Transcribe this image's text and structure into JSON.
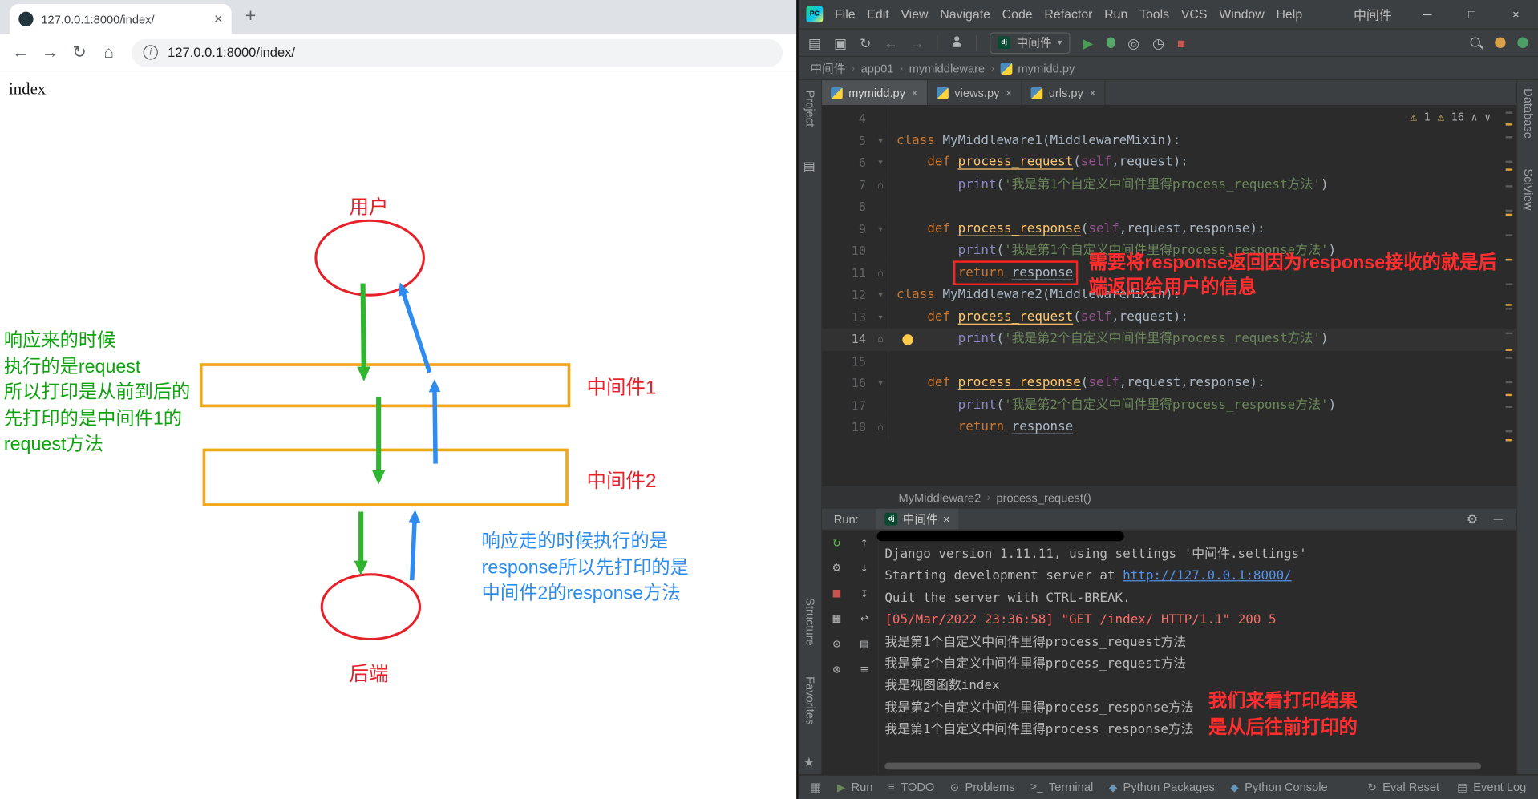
{
  "icons": {
    "close": "×",
    "new_tab": "+",
    "back": "←",
    "forward": "→",
    "reload": "↻",
    "home": "⌂",
    "info": "i",
    "min": "─",
    "max": "□",
    "win_close": "×",
    "crumb_sep": "›",
    "warning": "⚠",
    "up": "∧",
    "down": "∨",
    "gear": "⚙",
    "hide": "─",
    "dropdown": "▾",
    "folder": "▤",
    "star": "★",
    "grid": "▦",
    "django": "dj",
    "pycharm": "PC"
  },
  "browser": {
    "tab_title": "127.0.0.1:8000/index/",
    "url": "127.0.0.1:8000/index/",
    "page_heading": "index",
    "diagram": {
      "user_label": "用户",
      "mw1_label": "中间件1",
      "mw2_label": "中间件2",
      "backend_label": "后端",
      "green_note": [
        "响应来的时候",
        "执行的是request",
        "所以打印是从前到后的",
        "先打印的是中间件1的",
        "request方法"
      ],
      "blue_note": [
        "响应走的时候执行的是",
        "response所以先打印的是",
        "中间件2的response方法"
      ],
      "colors": {
        "shape_red": "#e62129",
        "box_yellow": "#efa71c",
        "arrow_green": "#2fb52f",
        "arrow_blue": "#2e8bf0",
        "green_text": "#0fa30f",
        "blue_text": "#2b8ced"
      }
    }
  },
  "ide": {
    "project_title": "中间件",
    "menus": [
      "File",
      "Edit",
      "View",
      "Navigate",
      "Code",
      "Refactor",
      "Run",
      "Tools",
      "VCS",
      "Window",
      "Help"
    ],
    "toolbar": {
      "pre_icons": [
        {
          "name": "open-icon",
          "glyph": "▤",
          "color": "#afb1b3"
        },
        {
          "name": "save-icon",
          "glyph": "▣",
          "color": "#afb1b3"
        },
        {
          "name": "sync-icon",
          "glyph": "↻",
          "color": "#afb1b3"
        },
        {
          "name": "back-icon",
          "glyph": "←",
          "color": "#afb1b3"
        },
        {
          "name": "forward-icon",
          "glyph": "→",
          "color": "#787b7e"
        }
      ],
      "config_name": "中间件",
      "post_icons": [
        {
          "name": "run-icon",
          "glyph": "▶",
          "color": "#499c54"
        },
        {
          "name": "coverage-icon",
          "glyph": "◎",
          "color": "#afb1b3"
        },
        {
          "name": "profiler-icon",
          "glyph": "◷",
          "color": "#afb1b3"
        },
        {
          "name": "stop-icon",
          "glyph": "■",
          "color": "#c75450"
        }
      ]
    },
    "breadcrumbs": [
      "中间件",
      "app01",
      "mymiddleware",
      "mymidd.py"
    ],
    "left_strip": [
      "Project",
      "Structure",
      "Favorites"
    ],
    "right_strip": [
      "Database",
      "SciView"
    ],
    "tabs": [
      {
        "label": "mymidd.py",
        "active": true
      },
      {
        "label": "views.py",
        "active": false
      },
      {
        "label": "urls.py",
        "active": false
      }
    ],
    "inspections": {
      "w1": "1",
      "w2": "16"
    },
    "editor_lines": [
      {
        "n": 4,
        "t": []
      },
      {
        "n": 5,
        "fold": "arrow",
        "t": [
          [
            "k",
            "class "
          ],
          [
            "p",
            "MyMiddleware1(MiddlewareMixin):"
          ]
        ]
      },
      {
        "n": 6,
        "fold": "arrow",
        "t": [
          [
            "p",
            "    "
          ],
          [
            "k",
            "def "
          ],
          [
            "f",
            "process_request"
          ],
          [
            "p",
            "("
          ],
          [
            "s",
            "self"
          ],
          [
            "p",
            ","
          ],
          [
            "p",
            "request"
          ],
          [
            "p",
            "):"
          ]
        ]
      },
      {
        "n": 7,
        "fold": "end",
        "t": [
          [
            "p",
            "        "
          ],
          [
            "b",
            "print"
          ],
          [
            "p",
            "("
          ],
          [
            "g",
            "'我是第1个自定义中间件里得process_request方法'"
          ],
          [
            "p",
            ")"
          ]
        ]
      },
      {
        "n": 8,
        "t": []
      },
      {
        "n": 9,
        "fold": "arrow",
        "t": [
          [
            "p",
            "    "
          ],
          [
            "k",
            "def "
          ],
          [
            "f",
            "process_response"
          ],
          [
            "p",
            "("
          ],
          [
            "s",
            "self"
          ],
          [
            "p",
            ","
          ],
          [
            "p",
            "request"
          ],
          [
            "p",
            ","
          ],
          [
            "p",
            "response"
          ],
          [
            "p",
            "):"
          ]
        ]
      },
      {
        "n": 10,
        "t": [
          [
            "p",
            "        "
          ],
          [
            "b",
            "print"
          ],
          [
            "p",
            "("
          ],
          [
            "g",
            "'我是第1个自定义中间件里得process_response方法'"
          ],
          [
            "p",
            ")"
          ]
        ]
      },
      {
        "n": 11,
        "fold": "end",
        "box": true,
        "t": [
          [
            "p",
            "        "
          ],
          [
            "k",
            "return "
          ],
          [
            "u",
            "response"
          ]
        ]
      },
      {
        "n": 12,
        "fold": "arrow",
        "t": [
          [
            "k",
            "class "
          ],
          [
            "p",
            "MyMiddleware2(MiddlewareMixin):"
          ]
        ]
      },
      {
        "n": 13,
        "fold": "arrow",
        "t": [
          [
            "p",
            "    "
          ],
          [
            "k",
            "def "
          ],
          [
            "f",
            "process_request"
          ],
          [
            "p",
            "("
          ],
          [
            "s",
            "self"
          ],
          [
            "p",
            ","
          ],
          [
            "p",
            "request"
          ],
          [
            "p",
            "):"
          ]
        ]
      },
      {
        "n": 14,
        "current": true,
        "bulb": true,
        "fold": "end",
        "t": [
          [
            "p",
            "        "
          ],
          [
            "b",
            "print"
          ],
          [
            "p",
            "("
          ],
          [
            "g",
            "'我是第2个自定义中间件里得process_request方法'"
          ],
          [
            "p",
            ")"
          ]
        ]
      },
      {
        "n": 15,
        "t": []
      },
      {
        "n": 16,
        "fold": "arrow",
        "t": [
          [
            "p",
            "    "
          ],
          [
            "k",
            "def "
          ],
          [
            "f",
            "process_response"
          ],
          [
            "p",
            "("
          ],
          [
            "s",
            "self"
          ],
          [
            "p",
            ","
          ],
          [
            "p",
            "request"
          ],
          [
            "p",
            ","
          ],
          [
            "p",
            "response"
          ],
          [
            "p",
            "):"
          ]
        ]
      },
      {
        "n": 17,
        "t": [
          [
            "p",
            "        "
          ],
          [
            "b",
            "print"
          ],
          [
            "p",
            "("
          ],
          [
            "g",
            "'我是第2个自定义中间件里得process_response方法'"
          ],
          [
            "p",
            ")"
          ]
        ]
      },
      {
        "n": 18,
        "fold": "end",
        "t": [
          [
            "p",
            "        "
          ],
          [
            "k",
            "return "
          ],
          [
            "u",
            "response"
          ]
        ]
      }
    ],
    "annotation": [
      "需要将response返回因为response接收的就是后",
      "端返回给用户的信息"
    ],
    "editor_breadcrumb": [
      "MyMiddleware2",
      "process_request()"
    ],
    "run_panel": {
      "label": "Run:",
      "tab_label": "中间件",
      "col1": [
        {
          "name": "rerun-icon",
          "glyph": "↻",
          "color": "#64b25b"
        },
        {
          "name": "settings-icon",
          "glyph": "⚙",
          "color": "#afb1b3"
        },
        {
          "name": "stop-icon",
          "glyph": "■",
          "color": "#c75450"
        },
        {
          "name": "dashboard-icon",
          "glyph": "▦",
          "color": "#afb1b3"
        },
        {
          "name": "pin-icon",
          "glyph": "⊙",
          "color": "#afb1b3"
        },
        {
          "name": "clear-icon",
          "glyph": "⊗",
          "color": "#afb1b3"
        }
      ],
      "col2": [
        {
          "name": "up-icon",
          "glyph": "↑",
          "color": "#afb1b3"
        },
        {
          "name": "down-icon",
          "glyph": "↓",
          "color": "#afb1b3"
        },
        {
          "name": "scroll-end-icon",
          "glyph": "↧",
          "color": "#afb1b3"
        },
        {
          "name": "soft-wrap-icon",
          "glyph": "↩",
          "color": "#afb1b3"
        },
        {
          "name": "print-icon",
          "glyph": "▤",
          "color": "#afb1b3"
        },
        {
          "name": "menu-icon",
          "glyph": "≡",
          "color": "#afb1b3"
        }
      ],
      "console": [
        {
          "type": "clipped",
          "text": ""
        },
        {
          "type": "out",
          "text": "Django version 1.11.11, using settings '中间件.settings'"
        },
        {
          "type": "link",
          "prefix": "Starting development server at ",
          "link": "http://127.0.0.1:8000/"
        },
        {
          "type": "out",
          "text": "Quit the server with CTRL-BREAK."
        },
        {
          "type": "err",
          "text": "[05/Mar/2022 23:36:58] \"GET /index/ HTTP/1.1\" 200 5"
        },
        {
          "type": "out",
          "text": "我是第1个自定义中间件里得process_request方法"
        },
        {
          "type": "out",
          "text": "我是第2个自定义中间件里得process_request方法"
        },
        {
          "type": "out",
          "text": "我是视图函数index"
        },
        {
          "type": "out",
          "text": "我是第2个自定义中间件里得process_response方法"
        },
        {
          "type": "out",
          "text": "我是第1个自定义中间件里得process_response方法"
        }
      ],
      "annotation": [
        "我们来看打印结果",
        "是从后往前打印的"
      ]
    },
    "status_left": [
      {
        "label": "Run",
        "glyph": "▶",
        "color": "#6a8759"
      },
      {
        "label": "TODO",
        "glyph": "≡",
        "color": "#9da0a3"
      },
      {
        "label": "Problems",
        "glyph": "⊙",
        "color": "#9da0a3"
      },
      {
        "label": "Terminal",
        "glyph": ">_",
        "color": "#9da0a3"
      },
      {
        "label": "Python Packages",
        "glyph": "◆",
        "color": "#6897bb"
      },
      {
        "label": "Python Console",
        "glyph": "◆",
        "color": "#6897bb"
      }
    ],
    "status_right": [
      {
        "label": "Eval Reset",
        "glyph": "↻",
        "color": "#9da0a3"
      },
      {
        "label": "Event Log",
        "glyph": "▤",
        "color": "#9da0a3"
      }
    ]
  }
}
